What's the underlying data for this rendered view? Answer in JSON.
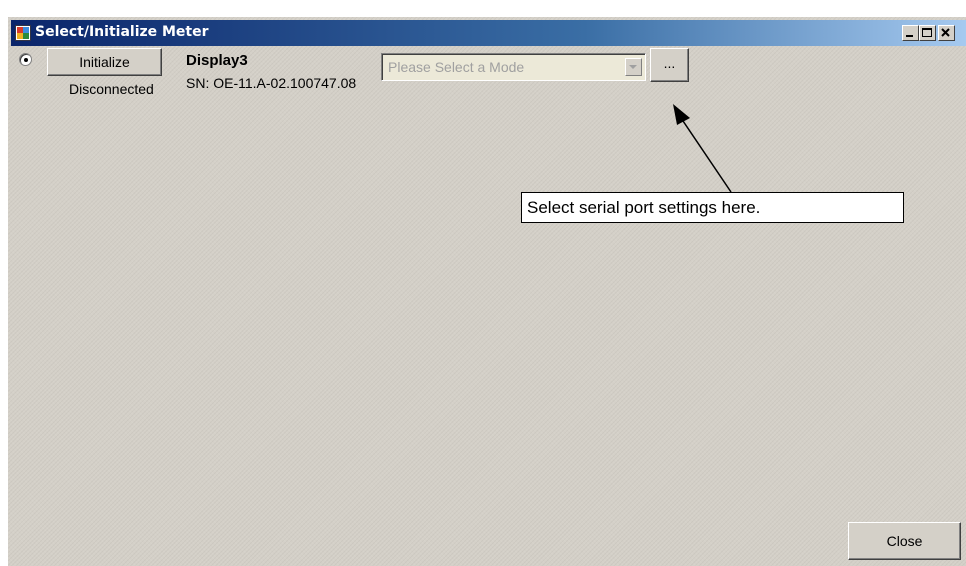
{
  "window": {
    "title": "Select/Initialize Meter",
    "controls": [
      "minimize-icon",
      "maximize-icon",
      "close-icon"
    ],
    "colors": {
      "titlebar_start": "#0a246a",
      "titlebar_end": "#a6caf0",
      "face": "#d4d0c8"
    }
  },
  "meter": {
    "selected": true,
    "initialize_label": "Initialize",
    "status": "Disconnected",
    "name": "Display3",
    "serial": "SN: OE-11.A-02.100747.08",
    "mode_placeholder": "Please Select a Mode",
    "settings_button_label": "..."
  },
  "callout": {
    "text": "Select serial port settings here."
  },
  "footer": {
    "close_label": "Close"
  }
}
